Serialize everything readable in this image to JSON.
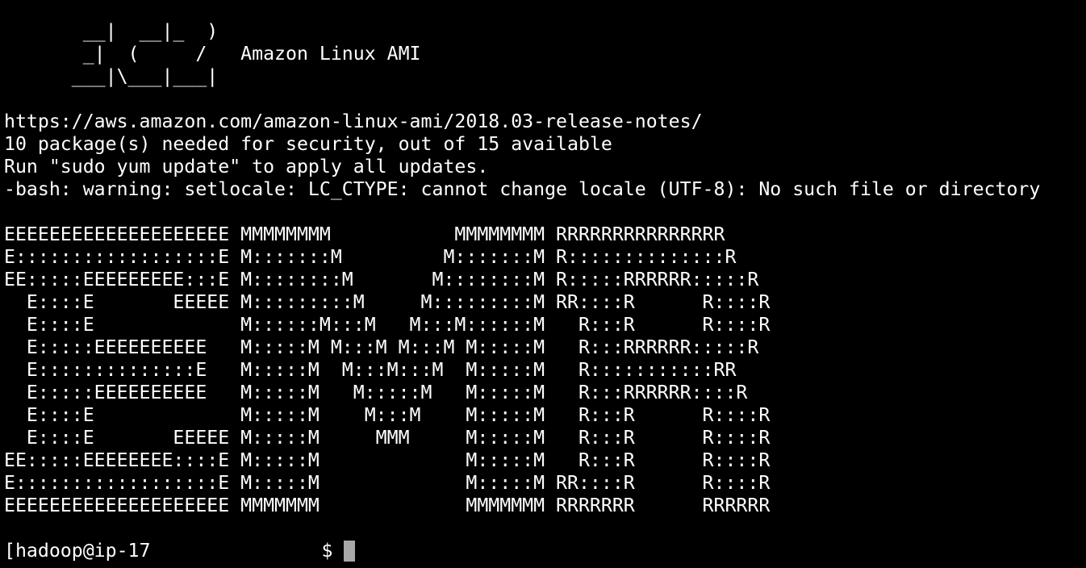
{
  "banner": {
    "lines": [
      "       __|  __|_  )",
      "       _|  (     /   Amazon Linux AMI",
      "      ___|\\___|___|"
    ]
  },
  "motd": {
    "release_url": "https://aws.amazon.com/amazon-linux-ami/2018.03-release-notes/",
    "packages_notice": "10 package(s) needed for security, out of 15 available",
    "update_hint": "Run \"sudo yum update\" to apply all updates.",
    "locale_warning": "-bash: warning: setlocale: LC_CTYPE: cannot change locale (UTF-8): No such file or directory"
  },
  "emr_logo": {
    "lines": [
      "EEEEEEEEEEEEEEEEEEEE MMMMMMMM           MMMMMMMM RRRRRRRRRRRRRRR",
      "E::::::::::::::::::E M:::::::M         M:::::::M R::::::::::::::R",
      "EE:::::EEEEEEEEE:::E M::::::::M       M::::::::M R:::::RRRRRR:::::R",
      "  E::::E       EEEEE M:::::::::M     M:::::::::M RR::::R      R::::R",
      "  E::::E             M::::::M:::M   M:::M::::::M   R:::R      R::::R",
      "  E:::::EEEEEEEEEE   M:::::M M:::M M:::M M:::::M   R:::RRRRRR:::::R",
      "  E::::::::::::::E   M:::::M  M:::M:::M  M:::::M   R:::::::::::RR",
      "  E:::::EEEEEEEEEE   M:::::M   M:::::M   M:::::M   R:::RRRRRR::::R",
      "  E::::E             M:::::M    M:::M    M:::::M   R:::R      R::::R",
      "  E::::E       EEEEE M:::::M     MMM     M:::::M   R:::R      R::::R",
      "EE:::::EEEEEEEE::::E M:::::M             M:::::M   R:::R      R::::R",
      "E::::::::::::::::::E M:::::M             M:::::M RR::::R      R::::R",
      "EEEEEEEEEEEEEEEEEEEE MMMMMMM             MMMMMMM RRRRRRR      RRRRRR"
    ]
  },
  "prompt": {
    "prefix": "[hadoop@ip-17",
    "suffix": " $ "
  },
  "colors": {
    "background": "#000000",
    "foreground": "#ffffff",
    "cursor": "#a8a8a8"
  }
}
